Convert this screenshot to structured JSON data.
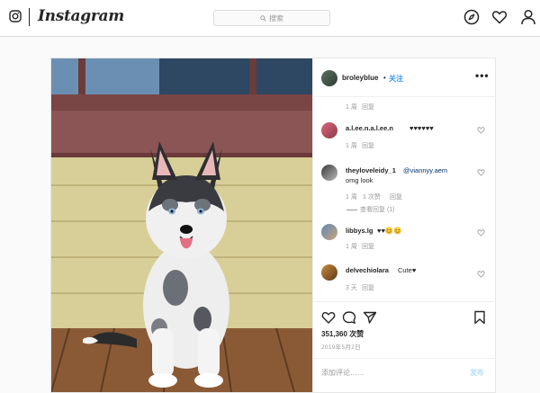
{
  "topbar": {
    "brand": "Instagram",
    "search_placeholder": "搜索"
  },
  "post": {
    "author": "broleyblue",
    "separator": "•",
    "follow_label": "关注",
    "more_label": "•••",
    "comments": [
      {
        "user": "",
        "text": "",
        "time": "1 周",
        "reply": "回复"
      },
      {
        "user": "a.l.ee.n.a.l.ee.n",
        "text": "♥♥♥♥♥♥",
        "time": "1 周",
        "reply": "回复"
      },
      {
        "user": "theyloveleidy_1",
        "mention": "@viannyy.aem",
        "text": "omg look",
        "time": "1 周",
        "likes": "1 次赞",
        "reply": "回复",
        "view_replies": "查看回复 (1)"
      },
      {
        "user": "libbys.lg",
        "text": "♥♥😊😊",
        "time": "1 周",
        "reply": "回复"
      },
      {
        "user": "delvechiolara",
        "text": "Cute♥",
        "time": "3 天",
        "reply": "回复"
      }
    ],
    "like_count": "351,360 次赞",
    "date": "2019年5月2日",
    "add_comment_placeholder": "添加评论……",
    "post_button": "发布"
  },
  "colors": {
    "link_blue": "#3897f0",
    "border": "#dbdbdb",
    "muted_text": "#999999"
  }
}
